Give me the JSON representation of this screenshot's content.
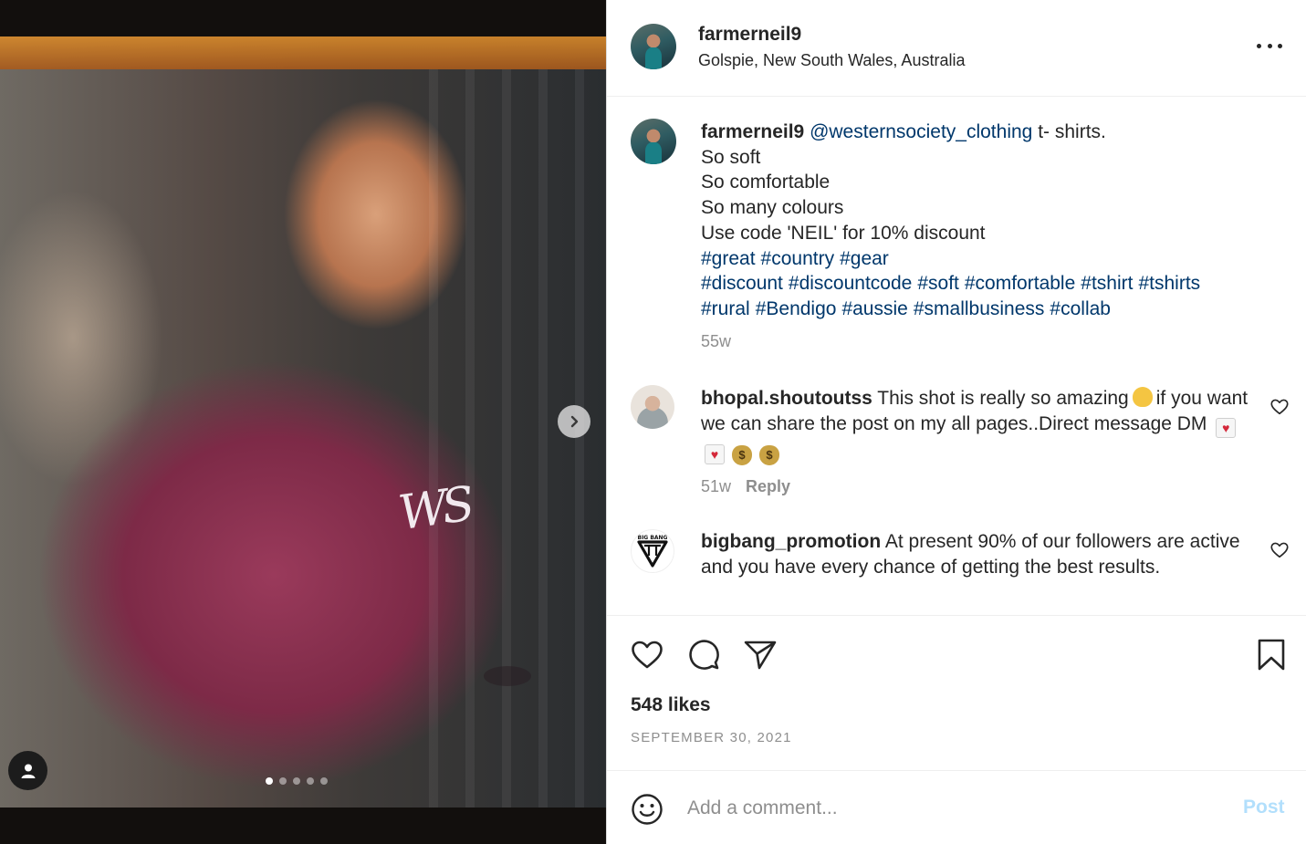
{
  "post": {
    "username": "farmerneil9",
    "location": "Golspie, New South Wales, Australia",
    "more_icon": "more-horizontal-icon",
    "carousel_count": 5,
    "carousel_active": 1,
    "media_tshirt_text": "WS"
  },
  "caption": {
    "username": "farmerneil9",
    "mention": "@westernsociety_clothing",
    "first_line_rest": "t- shirts.",
    "lines": [
      "So soft",
      "So comfortable",
      "So many colours",
      "Use code 'NEIL' for 10% discount"
    ],
    "hashtag_lines": [
      [
        "#great",
        "#country",
        "#gear"
      ],
      [
        "#discount",
        "#discountcode",
        "#soft",
        "#comfortable",
        "#tshirt",
        "#tshirts"
      ],
      [
        "#rural",
        "#Bendigo",
        "#aussie",
        "#smallbusiness",
        "#collab"
      ]
    ],
    "age": "55w"
  },
  "comments": [
    {
      "username": "bhopal.shoutoutss",
      "text_part1": "This shot is really so amazing",
      "text_part2": "if you want we can share the post on my all pages..Direct message DM",
      "age": "51w",
      "reply_label": "Reply"
    },
    {
      "username": "bigbang_promotion",
      "avatar_text": "BIG BANG",
      "text": "At present 90% of our followers are active and you have every chance of getting the best results."
    }
  ],
  "actions": {
    "icons": [
      "heart-icon",
      "comment-icon",
      "share-icon",
      "bookmark-icon"
    ],
    "likes": "548 likes",
    "date": "SEPTEMBER 30, 2021"
  },
  "add_comment": {
    "placeholder": "Add a comment...",
    "post_label": "Post"
  },
  "colors": {
    "link": "#00376b",
    "muted": "#8e8e8e",
    "post_button_disabled": "#b2dffc"
  }
}
